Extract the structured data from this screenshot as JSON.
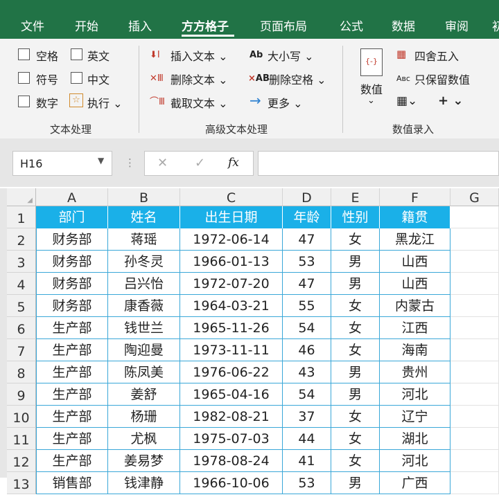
{
  "tabs": [
    "文件",
    "开始",
    "插入",
    "方方格子",
    "页面布局",
    "公式",
    "数据",
    "审阅",
    "初"
  ],
  "active_tab_index": 3,
  "ribbon": {
    "group1": {
      "checkboxes": [
        "空格",
        "英文",
        "符号",
        "中文",
        "数字"
      ],
      "execute_label": "执行",
      "title": "文本处理"
    },
    "group2": {
      "insert_text": "插入文本",
      "delete_text": "删除文本",
      "extract_text": "截取文本",
      "case_label": "大小写",
      "delete_space": "删除空格",
      "more_label": "更多",
      "title": "高级文本处理"
    },
    "group3": {
      "numeric_label": "数值",
      "round_label": "四舍五入",
      "keep_values": "只保留数值",
      "title": "数值录入"
    }
  },
  "formula_bar": {
    "cell_ref": "H16",
    "fx": "fx",
    "cancel": "✕",
    "confirm": "✓",
    "value": ""
  },
  "columns": [
    "A",
    "B",
    "C",
    "D",
    "E",
    "F",
    "G"
  ],
  "rows": [
    "1",
    "2",
    "3",
    "4",
    "5",
    "6",
    "7",
    "8",
    "9",
    "10",
    "11",
    "12",
    "13"
  ],
  "table": {
    "headers": [
      "部门",
      "姓名",
      "出生日期",
      "年龄",
      "性别",
      "籍贯"
    ],
    "rows": [
      [
        "财务部",
        "蒋瑶",
        "1972-06-14",
        "47",
        "女",
        "黑龙江"
      ],
      [
        "财务部",
        "孙冬灵",
        "1966-01-13",
        "53",
        "男",
        "山西"
      ],
      [
        "财务部",
        "吕兴怡",
        "1972-07-20",
        "47",
        "男",
        "山西"
      ],
      [
        "财务部",
        "康香薇",
        "1964-03-21",
        "55",
        "女",
        "内蒙古"
      ],
      [
        "生产部",
        "钱世兰",
        "1965-11-26",
        "54",
        "女",
        "江西"
      ],
      [
        "生产部",
        "陶迎曼",
        "1973-11-11",
        "46",
        "女",
        "海南"
      ],
      [
        "生产部",
        "陈凤美",
        "1976-06-22",
        "43",
        "男",
        "贵州"
      ],
      [
        "生产部",
        "姜舒",
        "1965-04-16",
        "54",
        "男",
        "河北"
      ],
      [
        "生产部",
        "杨珊",
        "1982-08-21",
        "37",
        "女",
        "辽宁"
      ],
      [
        "生产部",
        "尤枫",
        "1975-07-03",
        "44",
        "女",
        "湖北"
      ],
      [
        "生产部",
        "姜易梦",
        "1978-08-24",
        "41",
        "女",
        "河北"
      ],
      [
        "销售部",
        "钱津静",
        "1966-10-06",
        "53",
        "男",
        "广西"
      ]
    ]
  },
  "colors": {
    "accent": "#217346",
    "header_fill": "#1ab0e8",
    "cell_border": "#39a7d8"
  }
}
